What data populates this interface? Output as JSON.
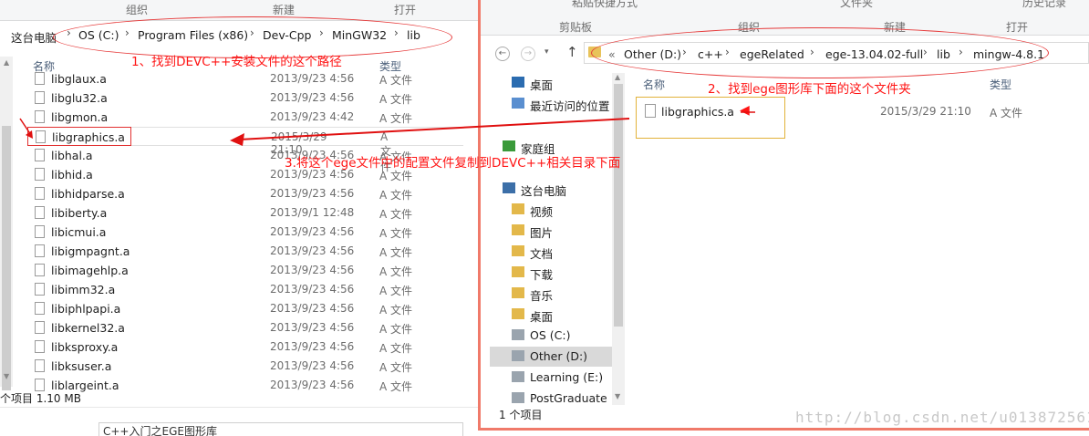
{
  "left_window": {
    "ribbon": [
      "组织",
      "新建",
      "打开"
    ],
    "breadcrumb": [
      "这台电脑",
      "OS (C:)",
      "Program Files (x86)",
      "Dev-Cpp",
      "MinGW32",
      "lib"
    ],
    "columns": {
      "name": "名称",
      "type": "类型"
    },
    "files": [
      {
        "name": "libglaux.a",
        "date": "2013/9/23 4:56",
        "type": "A 文件"
      },
      {
        "name": "libglu32.a",
        "date": "2013/9/23 4:56",
        "type": "A 文件"
      },
      {
        "name": "libgmon.a",
        "date": "2013/9/23 4:42",
        "type": "A 文件"
      },
      {
        "name": "libgraphics.a",
        "date": "2015/3/29 21:10",
        "type": "A 文件"
      },
      {
        "name": "libhal.a",
        "date": "2013/9/23 4:56",
        "type": "A 文件"
      },
      {
        "name": "libhid.a",
        "date": "2013/9/23 4:56",
        "type": "A 文件"
      },
      {
        "name": "libhidparse.a",
        "date": "2013/9/23 4:56",
        "type": "A 文件"
      },
      {
        "name": "libiberty.a",
        "date": "2013/9/1 12:48",
        "type": "A 文件"
      },
      {
        "name": "libicmui.a",
        "date": "2013/9/23 4:56",
        "type": "A 文件"
      },
      {
        "name": "libigmpagnt.a",
        "date": "2013/9/23 4:56",
        "type": "A 文件"
      },
      {
        "name": "libimagehlp.a",
        "date": "2013/9/23 4:56",
        "type": "A 文件"
      },
      {
        "name": "libimm32.a",
        "date": "2013/9/23 4:56",
        "type": "A 文件"
      },
      {
        "name": "libiphlpapi.a",
        "date": "2013/9/23 4:56",
        "type": "A 文件"
      },
      {
        "name": "libkernel32.a",
        "date": "2013/9/23 4:56",
        "type": "A 文件"
      },
      {
        "name": "libksproxy.a",
        "date": "2013/9/23 4:56",
        "type": "A 文件"
      },
      {
        "name": "libksuser.a",
        "date": "2013/9/23 4:56",
        "type": "A 文件"
      },
      {
        "name": "liblargeint.a",
        "date": "2013/9/23 4:56",
        "type": "A 文件"
      }
    ],
    "status": "个项目   1.10 MB",
    "bottom_text": "C++入门之EGE图形库"
  },
  "right_window": {
    "ribbon": {
      "paste_shortcut": "粘贴快捷方式",
      "clipboard": "剪贴板",
      "organize": "组织",
      "new_file": "文件夹",
      "new": "新建",
      "open": "打开",
      "history": "历史记录"
    },
    "breadcrumb": [
      "Other (D:)",
      "c++",
      "egeRelated",
      "ege-13.04.02-full",
      "lib",
      "mingw-4.8.1"
    ],
    "breadcrumb_prefix": "«",
    "columns": {
      "name": "名称",
      "type": "类型"
    },
    "files": [
      {
        "name": "libgraphics.a",
        "date": "2015/3/29 21:10",
        "type": "A 文件"
      }
    ],
    "nav": [
      {
        "label": "桌面",
        "icon": "desktop-icon"
      },
      {
        "label": "最近访问的位置",
        "icon": "recent-places-icon"
      },
      {
        "label": "家庭组",
        "icon": "homegroup-icon"
      },
      {
        "label": "这台电脑",
        "icon": "computer-icon"
      },
      {
        "label": "视频",
        "icon": "videos-folder-icon"
      },
      {
        "label": "图片",
        "icon": "pictures-folder-icon"
      },
      {
        "label": "文档",
        "icon": "documents-folder-icon"
      },
      {
        "label": "下载",
        "icon": "downloads-folder-icon"
      },
      {
        "label": "音乐",
        "icon": "music-folder-icon"
      },
      {
        "label": "桌面",
        "icon": "desktop-folder-icon"
      },
      {
        "label": "OS (C:)",
        "icon": "drive-icon"
      },
      {
        "label": "Other (D:)",
        "icon": "drive-icon"
      },
      {
        "label": "Learning (E:)",
        "icon": "drive-icon"
      },
      {
        "label": "PostGraduate",
        "icon": "drive-icon"
      }
    ],
    "status": "1 个项目"
  },
  "annotations": {
    "step1": "1、找到DEVC++安装文件的这个路径",
    "step2": "2、找到ege图形库下面的这个文件夹",
    "step3": "3.将这个ege文件中的配置文件复制到DEVC++相关目录下面"
  },
  "watermark": "http://blog.csdn.net/u013872561",
  "colors": {
    "annotation_red": "#ff1414",
    "window_border": "#f07a6a",
    "header_blue": "#4c607a"
  }
}
